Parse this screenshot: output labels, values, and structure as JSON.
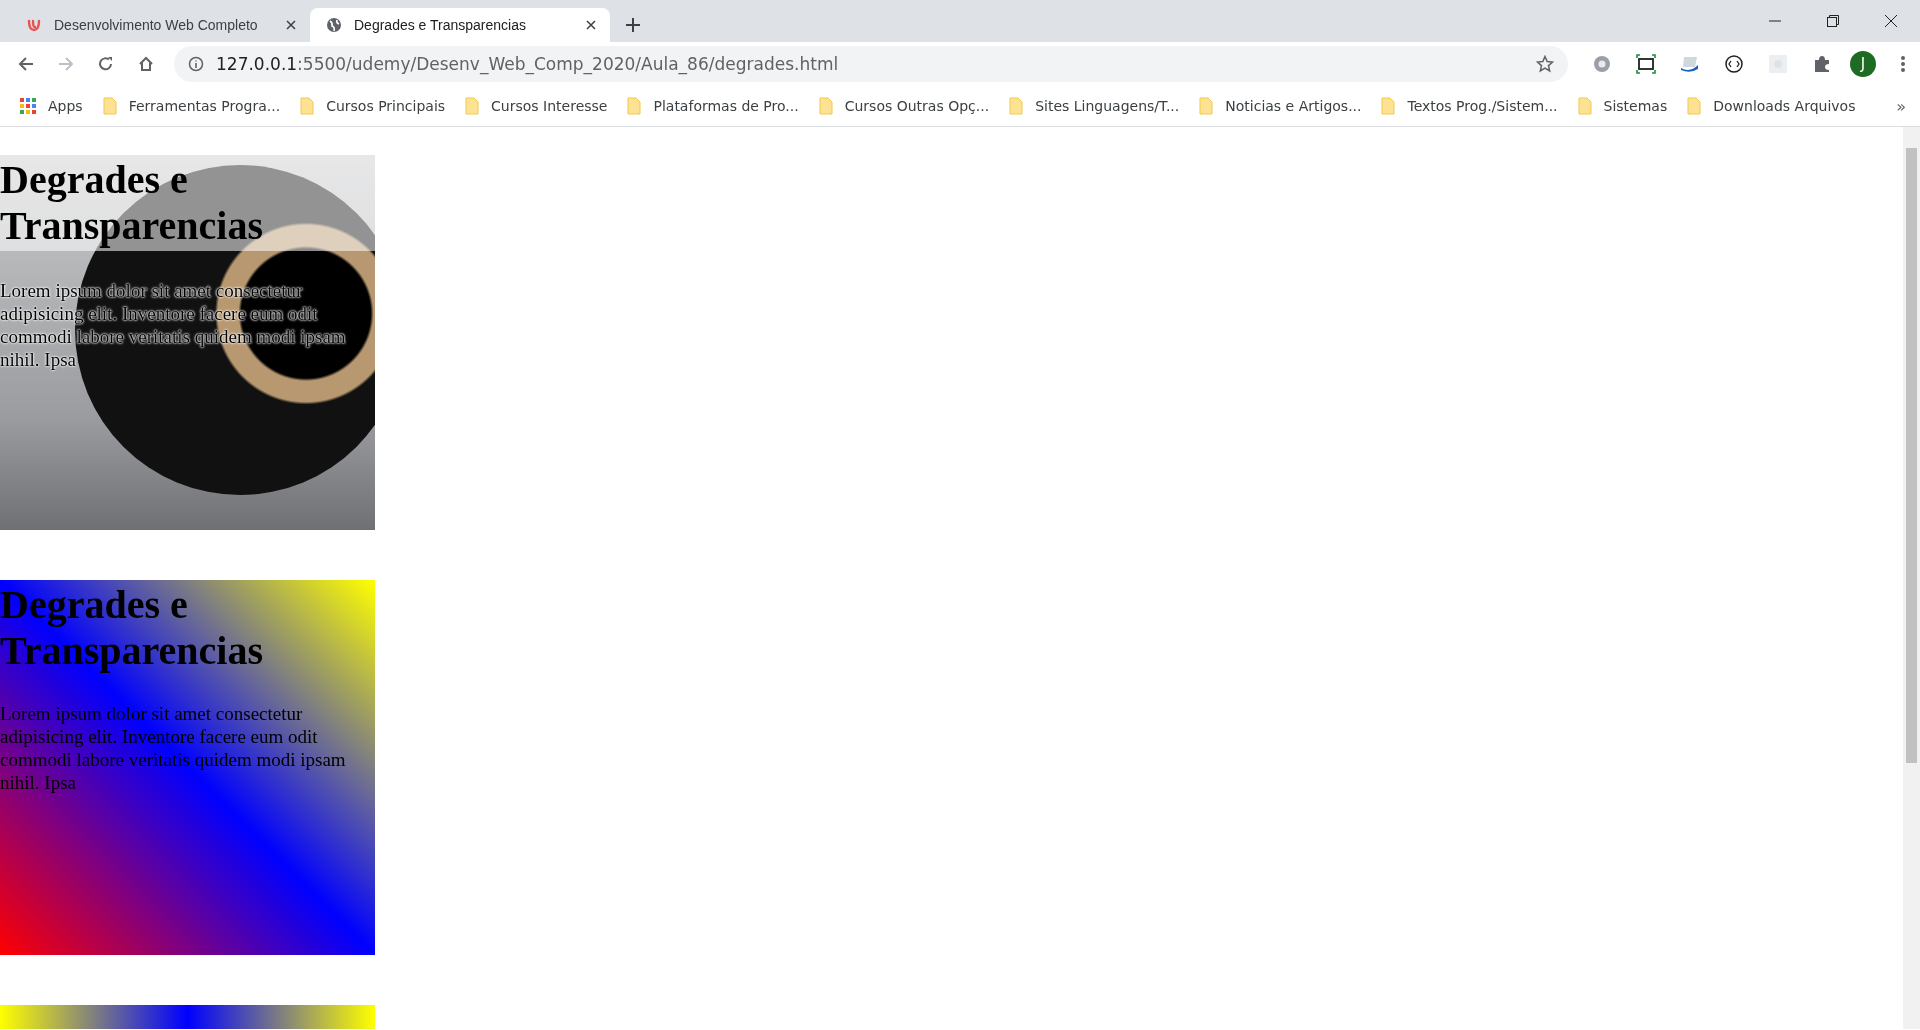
{
  "browser": {
    "tabs": [
      {
        "title": "Desenvolvimento Web Completo",
        "kind": "udemy",
        "selected": false
      },
      {
        "title": "Degrades e Transparencias",
        "kind": "globe",
        "selected": true
      }
    ],
    "address": {
      "host": "127.0.0.1",
      "path": ":5500/udemy/Desenv_Web_Comp_2020/Aula_86/degrades.html"
    },
    "bookmarks": [
      {
        "label": "Apps",
        "kind": "apps"
      },
      {
        "label": "Ferramentas Progra...",
        "kind": "folder"
      },
      {
        "label": "Cursos Principais",
        "kind": "folder"
      },
      {
        "label": "Cursos Interesse",
        "kind": "folder"
      },
      {
        "label": "Plataformas de Pro...",
        "kind": "folder"
      },
      {
        "label": "Cursos Outras Opç...",
        "kind": "folder"
      },
      {
        "label": "Sites Linguagens/T...",
        "kind": "folder"
      },
      {
        "label": "Noticias e Artigos...",
        "kind": "folder"
      },
      {
        "label": "Textos Prog./Sistem...",
        "kind": "folder"
      },
      {
        "label": "Sistemas",
        "kind": "folder"
      },
      {
        "label": "Downloads Arquivos",
        "kind": "folder"
      }
    ],
    "bookmarks_overflow": "»",
    "profile_initial": "J"
  },
  "page": {
    "cards": [
      {
        "kind": "photo",
        "heading": "Degrades e Transparencias",
        "text": "Lorem ipsum dolor sit amet consectetur adipisicing elit. Inventore facere eum odit commodi labore veritatis quidem modi ipsam nihil. Ipsa"
      },
      {
        "kind": "diagonal",
        "heading": "Degrades e Transparencias",
        "text": "Lorem ipsum dolor sit amet consectetur adipisicing elit. Inventore facere eum odit commodi labore veritatis quidem modi ipsam nihil. Ipsa"
      },
      {
        "kind": "horizontal"
      }
    ]
  }
}
